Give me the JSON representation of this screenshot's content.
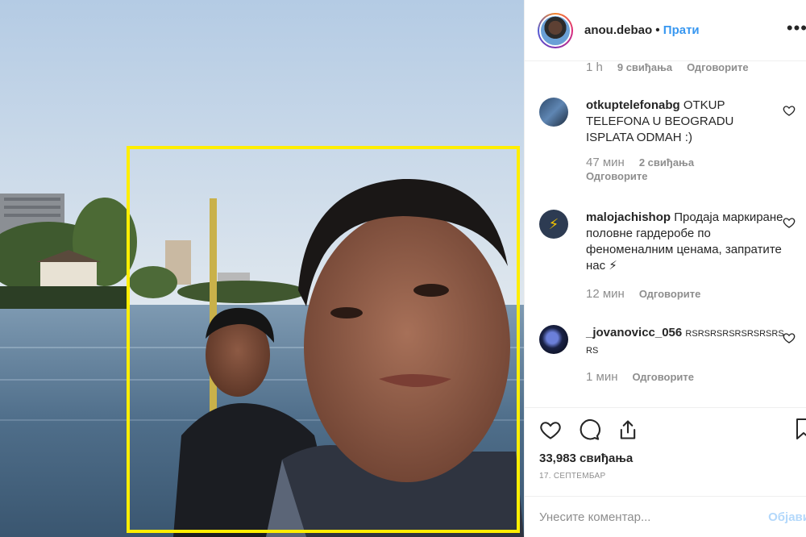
{
  "post": {
    "username": "anou.debao",
    "follow_label": "Прати",
    "separator": "•",
    "more_icon": "more-dots-icon"
  },
  "comments": {
    "first_meta": {
      "time": "1 h",
      "likes": "9 свиђања",
      "reply": "Одговорите"
    },
    "items": [
      {
        "user": "otkuptelefonabg",
        "text": "OTKUP TELEFONA U BEOGRADU ISPLATA ODMAH :)",
        "time": "47 мин",
        "likes": "2 свиђања",
        "reply": "Одговорите"
      },
      {
        "user": "malojachishop",
        "text": "Продаја маркиране половне гардеробе по феноменалним ценама, запратите нас ⚡",
        "time": "12 мин",
        "reply": "Одговорите"
      },
      {
        "user": "_jovanovicc_056",
        "text": "RSRSRSRSRSRSRSRS RS",
        "time": "1 мин",
        "reply": "Одговорите"
      }
    ]
  },
  "actions": {
    "like_count": "33,983 свиђања",
    "date": "17. септембар"
  },
  "comment_input": {
    "placeholder": "Унесите коментар...",
    "post_label": "Објави"
  },
  "colors": {
    "accent": "#3897f0",
    "highlight_box": "#ffee00",
    "muted": "#8e8e8e"
  }
}
